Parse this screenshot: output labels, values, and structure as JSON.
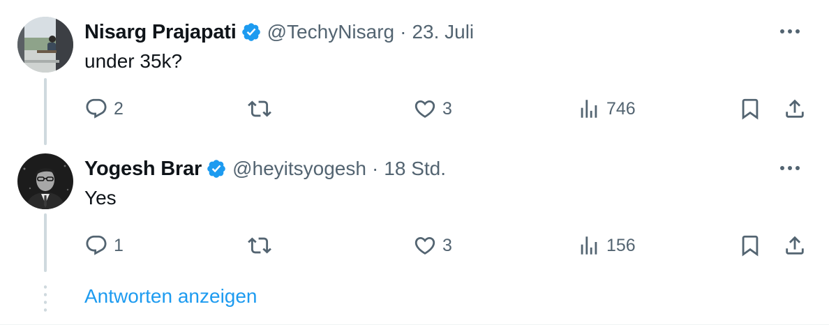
{
  "colors": {
    "accent": "#1d9bf0",
    "text_primary": "#0f1419",
    "text_secondary": "#536471",
    "thread_line": "#cfd9de"
  },
  "tweets": [
    {
      "display_name": "Nisarg Prajapati",
      "verified": true,
      "handle": "@TechyNisarg",
      "separator": "·",
      "time": "23. Juli",
      "text": "under 35k?",
      "more_icon": "more-horizontal-icon",
      "actions": {
        "reply": {
          "icon": "reply-icon",
          "count": "2"
        },
        "retweet": {
          "icon": "retweet-icon",
          "count": ""
        },
        "like": {
          "icon": "heart-icon",
          "count": "3"
        },
        "views": {
          "icon": "views-icon",
          "count": "746"
        },
        "bookmark": {
          "icon": "bookmark-icon"
        },
        "share": {
          "icon": "share-icon"
        }
      }
    },
    {
      "display_name": "Yogesh Brar",
      "verified": true,
      "handle": "@heyitsyogesh",
      "separator": "·",
      "time": "18 Std.",
      "text": "Yes",
      "more_icon": "more-horizontal-icon",
      "actions": {
        "reply": {
          "icon": "reply-icon",
          "count": "1"
        },
        "retweet": {
          "icon": "retweet-icon",
          "count": ""
        },
        "like": {
          "icon": "heart-icon",
          "count": "3"
        },
        "views": {
          "icon": "views-icon",
          "count": "156"
        },
        "bookmark": {
          "icon": "bookmark-icon"
        },
        "share": {
          "icon": "share-icon"
        }
      }
    }
  ],
  "show_replies": {
    "label": "Antworten anzeigen"
  }
}
